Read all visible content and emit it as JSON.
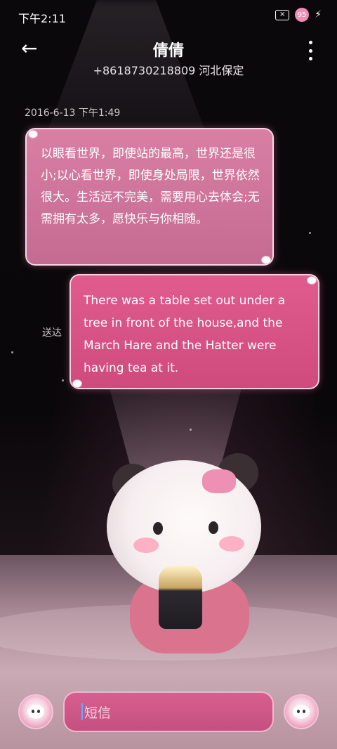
{
  "status_bar": {
    "time": "下午2:11",
    "battery_level": "95",
    "icons": [
      "screen-record-off-icon",
      "battery-badge-icon",
      "charging-bolt-icon"
    ]
  },
  "header": {
    "back_icon": "arrow-left-icon",
    "contact_name": "倩倩",
    "contact_detail": "+8618730218809 河北保定",
    "more_icon": "more-vertical-icon"
  },
  "conversation": {
    "timestamp": "2016-6-13 下午1:49",
    "messages": [
      {
        "direction": "incoming",
        "text": "以眼看世界，即使站的最高，世界还是很小;以心看世界，即使身处局限，世界依然很大。生活远不完美，需要用心去体会;无需拥有太多，愿快乐与你相随。"
      },
      {
        "direction": "outgoing",
        "text": "There was a table set out under a tree in front of the house,and the March Hare and the Hatter were having tea at it.",
        "status": "送达"
      }
    ]
  },
  "composer": {
    "placeholder": "短信",
    "left_icon": "sim-avatar-icon",
    "right_icon": "send-avatar-icon"
  },
  "colors": {
    "bubble_incoming": "#c9719a",
    "bubble_outgoing": "#d9528a",
    "input_bg": "#d05a8a",
    "background": "#070507"
  }
}
